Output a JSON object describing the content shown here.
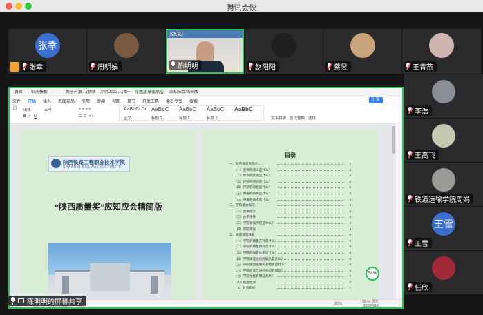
{
  "window": {
    "title": "腾讯会议"
  },
  "participants_top": [
    {
      "name": "张幸",
      "avatar_text": "张幸",
      "avatar_color": "#3b6fd0"
    },
    {
      "name": "周明娟",
      "avatar_text": "",
      "avatar_color": "#7a5a40"
    },
    {
      "name": "陈明明",
      "avatar_text": "",
      "avatar_color": "#5a7fa8",
      "speaking": true
    },
    {
      "name": "赵阳阳",
      "avatar_text": "",
      "avatar_color": "#1f1f1f"
    },
    {
      "name": "蔡昱",
      "avatar_text": "",
      "avatar_color": "#c9a37a"
    },
    {
      "name": "王青苗",
      "avatar_text": "",
      "avatar_color": "#d0b4b0"
    }
  ],
  "participants_right": [
    {
      "name": "李浩",
      "avatar_color": "#8a8f95"
    },
    {
      "name": "王高飞",
      "avatar_color": "#c5c7b0"
    },
    {
      "name": "铁道运输学院周娟",
      "avatar_color": "#9c9a97"
    },
    {
      "name": "王雪",
      "avatar_text": "王雪",
      "avatar_color": "#3b6fd0"
    },
    {
      "name": "任欣",
      "avatar_color": "#a12838"
    }
  ],
  "video_banner": "SXRI",
  "share": {
    "label": "陈明明的屏幕共享",
    "tabs": [
      "首页",
      "稻壳模板",
      "关于开展…(初稿)",
      "示例2023…(第一周)",
      "陕西质量奖简版",
      "应知应会精简版"
    ],
    "menus": [
      "文件",
      "开始",
      "插入",
      "页面布局",
      "引用",
      "审阅",
      "视图",
      "章节",
      "开发工具",
      "会员专享",
      "搜索"
    ],
    "ribbon_styles": [
      "正文",
      "标题 1",
      "标题 2",
      "标题 3"
    ],
    "ribbon_extra": [
      "文字排版",
      "查找替换",
      "选择"
    ],
    "sync_btn": "分享",
    "doc": {
      "school_name": "陕西铁路工程职业技术学院",
      "school_name_en": "SHAANXI RAILWAY INSTITUTE",
      "doc_title": "“陕西质量奖”应知应会精简版",
      "toc_title": "目录",
      "toc_entries": [
        "一、陕西质量奖简介……",
        "（一）奖项的意义是什么？",
        "（二）本次的奖项是什么？",
        "（三）评奖的原则是什么？",
        "（四）评奖的流程是什么？",
        "（五）申报的条件是什么？",
        "（六）申报的重点是什么？",
        "二、学院基本概况",
        "（一）基本简介",
        "（二）办学条件",
        "（三）学院发展历程是什么？",
        "（四）学院荣誉",
        "三、质量管理体系",
        "（一）学院的质量方针是什么？",
        "（二）学院的质量目标是什么？",
        "（三）学院的质量体系是什么？",
        "（四）学院质量文化的概念是什么？",
        "（五）学院质量控制的关键点是什么？",
        "（六）学院质量改进的举措有哪些？",
        "（七）学院文化有哪些亮点？",
        "（八）经营结果",
        "1．财务指标"
      ],
      "toc_pages": [
        "1",
        "2",
        "2",
        "2",
        "2",
        "2",
        "3",
        "3",
        "3",
        "3",
        "4",
        "4",
        "5",
        "5",
        "6",
        "6",
        "6",
        "6",
        "6",
        "7",
        "7",
        "7"
      ]
    },
    "status_left": "页面：1/12  字数：2984  拼写检查  文档校对",
    "status_right": "63%",
    "zoom_badge": "54%",
    "clock_time": "20:44",
    "clock_day": "周五",
    "clock_date": "2023/6/16"
  }
}
